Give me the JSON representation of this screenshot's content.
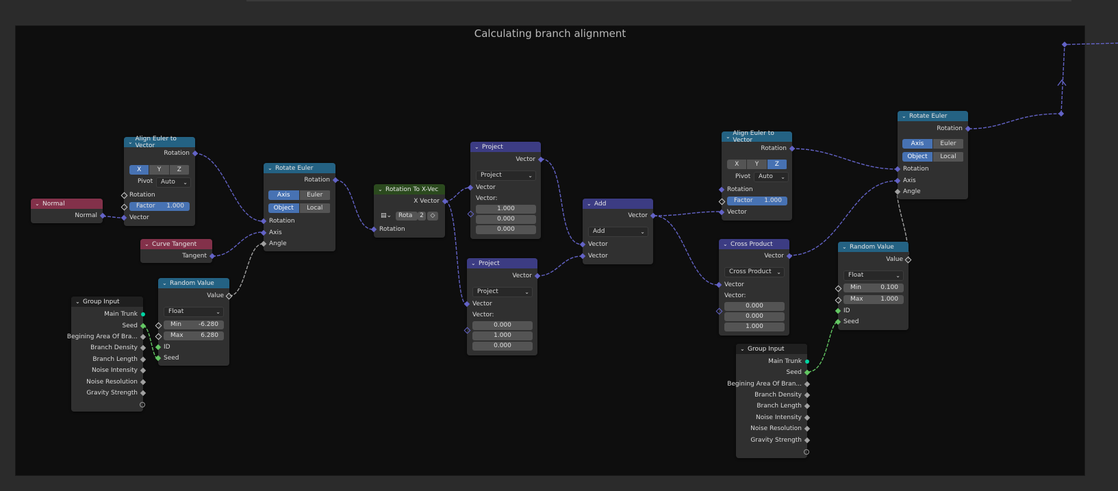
{
  "frame": {
    "title": "Calculating branch alignment"
  },
  "colors": {
    "canvas": "#0e0e0e",
    "node": "#303030",
    "vector_socket": "#6363c7",
    "float_socket": "#a1a1a1",
    "int_socket": "#63c763",
    "geometry_socket": "#00d6a3",
    "accent": "#4772b3"
  },
  "nodes": {
    "normal": {
      "title": "Normal",
      "out": "Normal"
    },
    "curve_tangent": {
      "title": "Curve Tangent",
      "out": "Tangent"
    },
    "align1": {
      "title": "Align Euler to Vector",
      "out": "Rotation",
      "axes": [
        "X",
        "Y",
        "Z"
      ],
      "pivot_label": "Pivot",
      "pivot_value": "Auto",
      "in_rotation": "Rotation",
      "factor_label": "Factor",
      "factor_value": "1.000",
      "in_vector": "Vector"
    },
    "rotate1": {
      "title": "Rotate Euler",
      "out": "Rotation",
      "mode1": [
        "Axis Angle",
        "Euler"
      ],
      "mode2": [
        "Object",
        "Local"
      ],
      "in_rotation": "Rotation",
      "in_axis": "Axis",
      "in_angle": "Angle"
    },
    "random1": {
      "title": "Random Value",
      "out": "Value",
      "type": "Float",
      "min_label": "Min",
      "min_value": "-6.280",
      "max_label": "Max",
      "max_value": "6.280",
      "id": "ID",
      "seed": "Seed"
    },
    "group1": {
      "title": "Group Input",
      "outputs": [
        "Main Trunk",
        "Seed",
        "Begining Area Of Bra...",
        "Branch Density",
        "Branch Length",
        "Noise Intensity",
        "Noise Resolution",
        "Gravity Strength"
      ]
    },
    "rot_to_x": {
      "title": "Rotation To X-Vec",
      "out": "X Vector",
      "field_value": "Rota",
      "field_num": "2",
      "in": "Rotation"
    },
    "project1": {
      "title": "Project",
      "out": "Vector",
      "op": "Project",
      "in_vector": "Vector",
      "vec_label": "Vector:",
      "values": [
        "1.000",
        "0.000",
        "0.000"
      ]
    },
    "project2": {
      "title": "Project",
      "out": "Vector",
      "op": "Project",
      "in_vector": "Vector",
      "vec_label": "Vector:",
      "values": [
        "0.000",
        "1.000",
        "0.000"
      ]
    },
    "add": {
      "title": "Add",
      "out": "Vector",
      "op": "Add",
      "in1": "Vector",
      "in2": "Vector"
    },
    "align2": {
      "title": "Align Euler to Vector",
      "out": "Rotation",
      "axes": [
        "X",
        "Y",
        "Z"
      ],
      "pivot_label": "Pivot",
      "pivot_value": "Auto",
      "in_rotation": "Rotation",
      "factor_label": "Factor",
      "factor_value": "1.000",
      "in_vector": "Vector"
    },
    "cross": {
      "title": "Cross Product",
      "out": "Vector",
      "op": "Cross Product",
      "in_vector": "Vector",
      "vec_label": "Vector:",
      "values": [
        "0.000",
        "0.000",
        "1.000"
      ]
    },
    "group2": {
      "title": "Group Input",
      "outputs": [
        "Main Trunk",
        "Seed",
        "Begining Area Of Bran...",
        "Branch Density",
        "Branch Length",
        "Noise Intensity",
        "Noise Resolution",
        "Gravity Strength"
      ]
    },
    "rotate2": {
      "title": "Rotate Euler",
      "out": "Rotation",
      "mode1": [
        "Axis Angle",
        "Euler"
      ],
      "mode2": [
        "Object",
        "Local"
      ],
      "in_rotation": "Rotation",
      "in_axis": "Axis",
      "in_angle": "Angle"
    },
    "random2": {
      "title": "Random Value",
      "out": "Value",
      "type": "Float",
      "min_label": "Min",
      "min_value": "0.100",
      "max_label": "Max",
      "max_value": "1.000",
      "id": "ID",
      "seed": "Seed"
    }
  }
}
